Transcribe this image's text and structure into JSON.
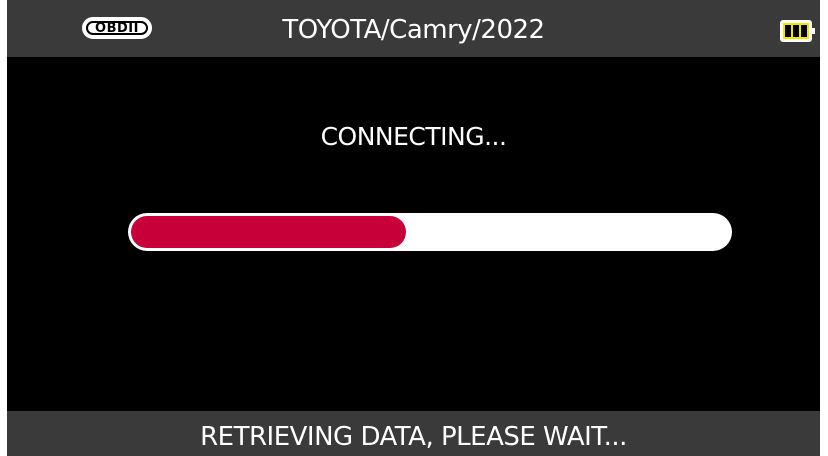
{
  "header": {
    "protocol_badge": "OBDII",
    "title": "TOYOTA/Camry/2022",
    "battery_icon": "battery-full-icon",
    "battery_level_fraction": 1.0,
    "battery_color": "#f2e600"
  },
  "main": {
    "status": "CONNECTING...",
    "progress_fraction": 0.46,
    "progress_color": "#c8003a"
  },
  "footer": {
    "message": "RETRIEVING DATA, PLEASE WAIT..."
  }
}
